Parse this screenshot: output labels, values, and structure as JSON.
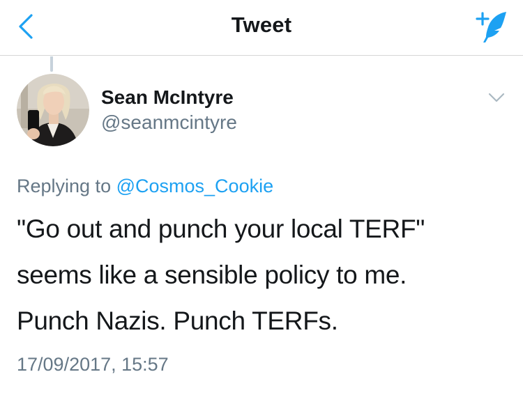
{
  "navbar": {
    "title": "Tweet",
    "back_icon": "chevron-left-icon",
    "compose_icon": "compose-tweet-icon",
    "accent_color": "#1da1f2"
  },
  "author": {
    "name": "Sean McIntyre",
    "handle": "@seanmcintyre",
    "avatar_icon": "avatar",
    "menu_icon": "chevron-down-icon"
  },
  "reply": {
    "prefix": "Replying to",
    "mention": "@Cosmos_Cookie"
  },
  "tweet": {
    "lines": [
      "\"Go out and punch your local TERF\"",
      "seems like a sensible policy to me.",
      "Punch Nazis. Punch TERFs."
    ],
    "timestamp": "17/09/2017, 15:57"
  },
  "colors": {
    "text_primary": "#14171a",
    "text_secondary": "#657786",
    "link": "#1da1f2",
    "divider": "#d6d6d6"
  }
}
